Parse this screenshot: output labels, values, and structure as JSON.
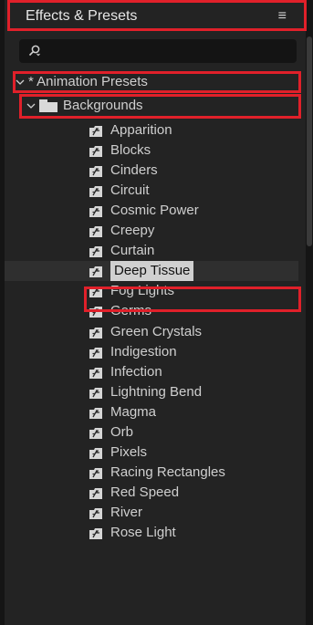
{
  "panel": {
    "title": "Effects & Presets",
    "menu_icon": "hamburger-menu-icon",
    "search": {
      "placeholder": "",
      "value": ""
    }
  },
  "tree": {
    "root": {
      "label": "* Animation Presets",
      "expanded": true
    },
    "folder": {
      "label": "Backgrounds",
      "expanded": true
    },
    "presets": [
      "Apparition",
      "Blocks",
      "Cinders",
      "Circuit",
      "Cosmic Power",
      "Creepy",
      "Curtain",
      "Deep Tissue",
      "Fog Lights",
      "Germs",
      "Green Crystals",
      "Indigestion",
      "Infection",
      "Lightning Bend",
      "Magma",
      "Orb",
      "Pixels",
      "Racing Rectangles",
      "Red Speed",
      "River",
      "Rose Light"
    ],
    "selected": "Deep Tissue"
  },
  "colors": {
    "highlight_border": "#e0202a",
    "panel_bg": "#232323",
    "search_bg": "#141414",
    "selection_bg": "#d0d0d0"
  }
}
